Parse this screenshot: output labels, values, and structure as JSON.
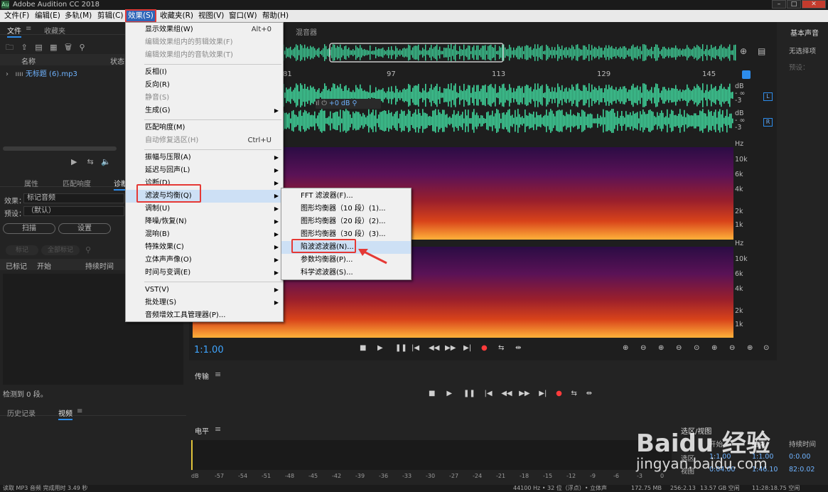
{
  "window": {
    "title": "Adobe Audition CC 2018",
    "app_icon": "Au"
  },
  "menubar": [
    {
      "label": "文件(F)"
    },
    {
      "label": "编辑(E)"
    },
    {
      "label": "多轨(M)"
    },
    {
      "label": "剪辑(C)"
    },
    {
      "label": "效果(S)"
    },
    {
      "label": "收藏夹(R)"
    },
    {
      "label": "视图(V)"
    },
    {
      "label": "窗口(W)"
    },
    {
      "label": "帮助(H)"
    }
  ],
  "files_panel": {
    "tab_files": "文件",
    "tab_favorites": "收藏夹",
    "col_name": "名称",
    "col_status": "状态",
    "file_name": "无标题 (6).mp3"
  },
  "props_panel": {
    "tab_properties": "属性",
    "tab_match": "匹配响度",
    "tab_diag": "诊断",
    "effect_label": "效果：",
    "effect_value": "标记音频",
    "preset_label": "预设：",
    "preset_value": "（默认）",
    "scan_btn": "扫描",
    "settings_btn": "设置",
    "mark_btn": "标记",
    "mark_all_btn": "全部标记",
    "col_marked": "已标记",
    "col_start": "开始",
    "col_duration": "持续时间",
    "detected": "检测到 0 段。"
  },
  "history_panel": {
    "tab_history": "历史记录",
    "tab_video": "视频"
  },
  "editor": {
    "tab_mixer": "混音器",
    "ruler": [
      "81",
      "97",
      "113",
      "129",
      "145"
    ],
    "db_labels": [
      "dB",
      "- ∞",
      "-3",
      "dB",
      "- ∞",
      "-3"
    ],
    "channel_l": "L",
    "channel_r": "R",
    "gain": "+0 dB",
    "hz_top": [
      "Hz",
      "10k",
      "6k",
      "4k",
      "2k",
      "1k"
    ],
    "hz_bottom": [
      "Hz",
      "10k",
      "6k",
      "4k",
      "2k",
      "1k"
    ],
    "timecode": "1:1.00"
  },
  "transport": {
    "title": "传输"
  },
  "levels": {
    "title": "电平",
    "scale": [
      "dB",
      "-57",
      "-54",
      "-51",
      "-48",
      "-45",
      "-42",
      "-39",
      "-36",
      "-33",
      "-30",
      "-27",
      "-24",
      "-21",
      "-18",
      "-15",
      "-12",
      "-9",
      "-6",
      "-3",
      "0"
    ]
  },
  "selection": {
    "title": "选区/视图",
    "col_start": "开始",
    "col_end": "结束",
    "col_duration": "持续时间",
    "row_sel": "选区",
    "row_view": "视图",
    "sel_start": "1:1.00",
    "sel_end": "1:1.00",
    "sel_dur": "0:0.00",
    "view_start": "0:04.00",
    "view_end": "1:46.10",
    "view_dur": "82:0.02"
  },
  "essential": {
    "title": "基本声音",
    "none_selected": "无选择项",
    "preset": "预设："
  },
  "status": {
    "left": "读取 MP3 音频 完成用时 3.49 秒",
    "rate": "44100 Hz • 32 位（浮点）• 立体声",
    "size": "172.75 MB",
    "dur": "256:2.13",
    "free": "13.57 GB 空闲",
    "time": "11:28:18.75 空闲"
  },
  "effects_menu": [
    {
      "label": "显示效果组(W)",
      "shortcut": "Alt+0",
      "disabled": false
    },
    {
      "label": "编辑效果组内的剪辑效果(F)",
      "disabled": true
    },
    {
      "label": "编辑效果组内的音轨效果(T)",
      "disabled": true
    },
    {
      "label": "反相(I)"
    },
    {
      "label": "反向(R)"
    },
    {
      "label": "静音(S)",
      "disabled": true
    },
    {
      "label": "生成(G)",
      "sub": true
    },
    {
      "label": "匹配响度(M)"
    },
    {
      "label": "自动修复选区(H)",
      "shortcut": "Ctrl+U",
      "disabled": true
    },
    {
      "label": "振幅与压限(A)",
      "sub": true
    },
    {
      "label": "延迟与回声(L)",
      "sub": true
    },
    {
      "label": "诊断(D)",
      "sub": true
    },
    {
      "label": "滤波与均衡(Q)",
      "sub": true
    },
    {
      "label": "调制(U)",
      "sub": true
    },
    {
      "label": "降噪/恢复(N)",
      "sub": true
    },
    {
      "label": "混响(B)",
      "sub": true
    },
    {
      "label": "特殊效果(C)",
      "sub": true
    },
    {
      "label": "立体声声像(O)",
      "sub": true
    },
    {
      "label": "时间与变调(E)",
      "sub": true
    },
    {
      "label": "VST(V)",
      "sub": true
    },
    {
      "label": "批处理(S)",
      "sub": true
    },
    {
      "label": "音频增效工具管理器(P)..."
    }
  ],
  "filter_submenu": [
    {
      "label": "FFT 滤波器(F)..."
    },
    {
      "label": "图形均衡器（10 段）(1)..."
    },
    {
      "label": "图形均衡器（20 段）(2)..."
    },
    {
      "label": "图形均衡器（30 段）(3)..."
    },
    {
      "label": "陷波滤波器(N)..."
    },
    {
      "label": "参数均衡器(P)..."
    },
    {
      "label": "科学滤波器(S)..."
    }
  ],
  "watermark": {
    "brand": "Baidu 经验",
    "url": "jingyan.baidu.com"
  },
  "colors": {
    "wave": "#3fd39a",
    "accent": "#2d8ceb",
    "highlight": "#e53935"
  }
}
